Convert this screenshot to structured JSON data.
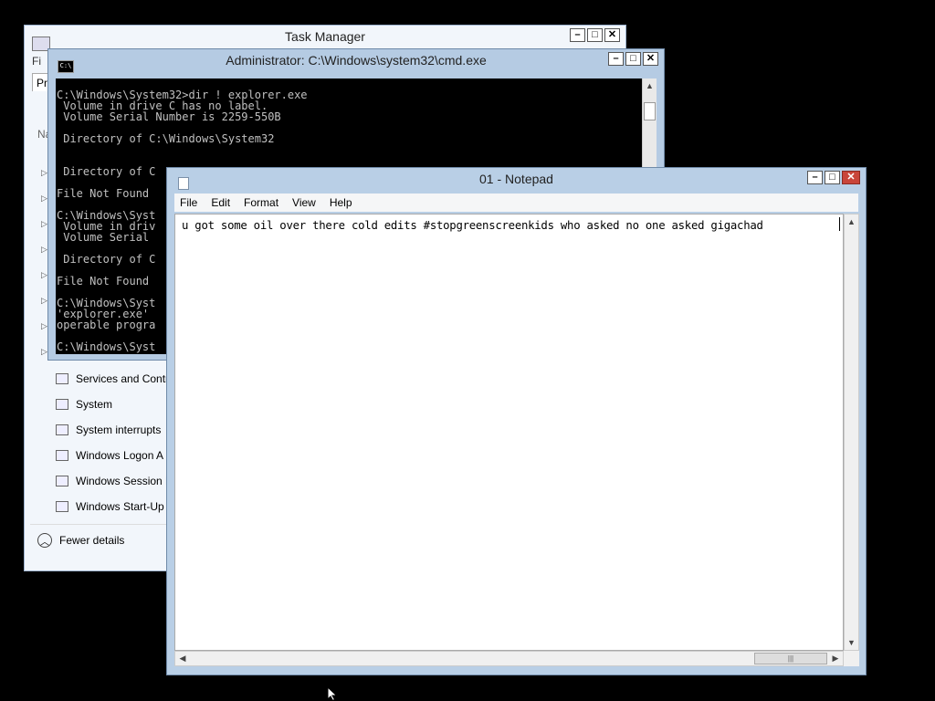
{
  "task_manager": {
    "title": "Task Manager",
    "menu_partial": "Fi",
    "tab_partial": "Pr",
    "column_partial": "Na",
    "services": [
      "Services and Contr",
      "System",
      "System interrupts",
      "Windows Logon A",
      "Windows Session M",
      "Windows Start-Up"
    ],
    "fewer_details": "Fewer details"
  },
  "cmd": {
    "title": "Administrator: C:\\Windows\\system32\\cmd.exe",
    "output": "C:\\Windows\\System32>dir ! explorer.exe\n Volume in drive C has no label.\n Volume Serial Number is 2259-550B\n\n Directory of C:\\Windows\\System32\n\n\n Directory of C\n\nFile Not Found\n\nC:\\Windows\\Syst\n Volume in driv\n Volume Serial\n\n Directory of C\n\nFile Not Found\n\nC:\\Windows\\Syst\n'explorer.exe'\noperable progra\n\nC:\\Windows\\Syst"
  },
  "notepad": {
    "title": "01 - Notepad",
    "menu": [
      "File",
      "Edit",
      "Format",
      "View",
      "Help"
    ],
    "content": "u got some oil over there cold edits #stopgreenscreenkids who asked no one asked gigachad"
  },
  "window_buttons": {
    "minimize": "–",
    "maximize": "□",
    "close": "✕"
  },
  "scroll_glyphs": {
    "up": "▲",
    "down": "▼",
    "left": "◀",
    "right": "▶",
    "grip": "|||"
  }
}
